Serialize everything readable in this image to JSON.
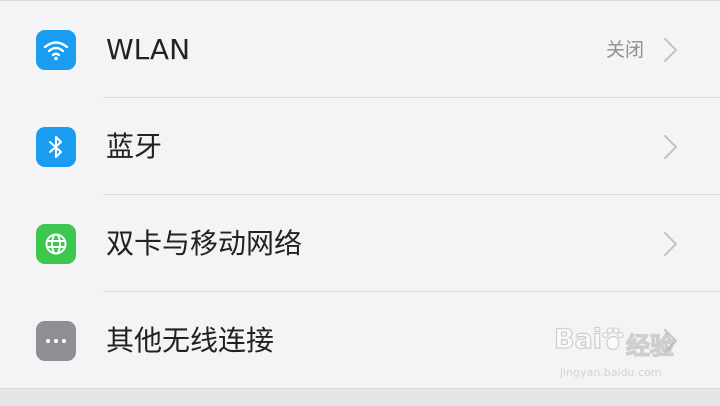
{
  "settings": {
    "items": [
      {
        "label": "WLAN",
        "value": "关闭",
        "icon": "wifi-icon",
        "icon_color": "#1a9cf0"
      },
      {
        "label": "蓝牙",
        "value": "",
        "icon": "bluetooth-icon",
        "icon_color": "#1a9cf0"
      },
      {
        "label": "双卡与移动网络",
        "value": "",
        "icon": "globe-icon",
        "icon_color": "#3ec74f"
      },
      {
        "label": "其他无线连接",
        "value": "",
        "icon": "more-dots-icon",
        "icon_color": "#8e8e93"
      }
    ]
  },
  "watermark": {
    "brand_left": "Bai",
    "brand_right": "经验",
    "url": "jingyan.baidu.com"
  }
}
